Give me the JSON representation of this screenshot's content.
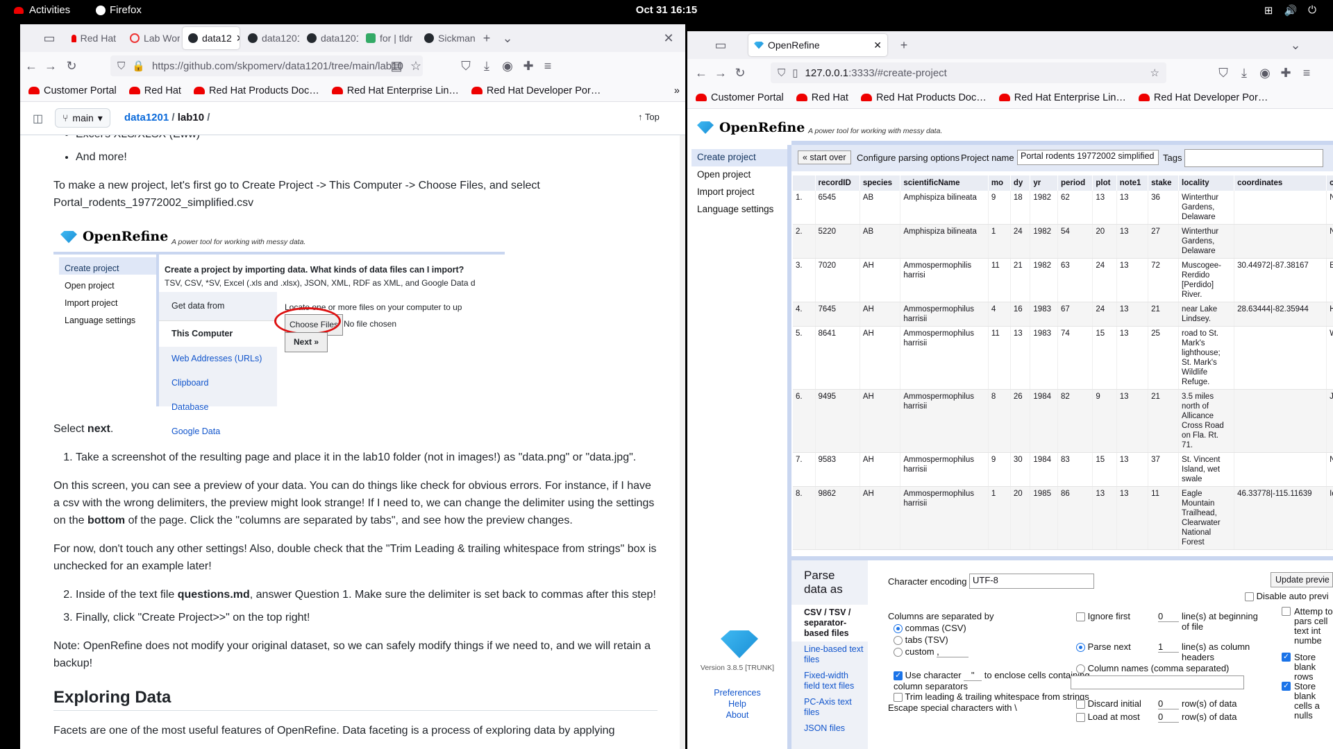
{
  "topbar": {
    "activities": "Activities",
    "app": "Firefox",
    "clock": "Oct 31  16:15"
  },
  "left": {
    "tabs": [
      "Red Hat",
      "Lab Wor",
      "data12",
      "data1201",
      "data1201",
      "for | tldr",
      "Sickman"
    ],
    "url": "https://github.com/skpomerv/data1201/tree/main/lab10",
    "url_host": "github.com",
    "bookmarks": [
      "Customer Portal",
      "Red Hat",
      "Red Hat Products Doc…",
      "Red Hat Enterprise Lin…",
      "Red Hat Developer Por…"
    ],
    "branch": "main",
    "crumb_repo": "data1201",
    "crumb_dir": "lab10",
    "top_label": "Top",
    "bullet1": "Excel's XLS/XLSX (Eww)",
    "bullet2": "And more!",
    "p1": "To make a new project, let's first go to Create Project -> This Computer -> Choose Files, and select Portal_rodents_19772002_simplified.csv",
    "embed": {
      "title": "OpenRefine",
      "tagline": "A power tool for working with messy data.",
      "nav": [
        "Create project",
        "Open project",
        "Import project",
        "Language settings"
      ],
      "heading": "Create a project by importing data. What kinds of data files can I import?",
      "formats": "TSV, CSV, *SV, Excel (.xls and .xlsx), JSON, XML, RDF as XML, and Google Data d",
      "sources_title": "Get data from",
      "sources": [
        "This Computer",
        "Web Addresses (URLs)",
        "Clipboard",
        "Database",
        "Google Data"
      ],
      "locate": "Locate one or more files on your computer to up",
      "choose": "Choose Files",
      "nofile": "No file chosen",
      "next": "Next »"
    },
    "p_select_a": "Select ",
    "p_select_b": "next",
    "p_select_c": ".",
    "ol1": "Take a screenshot of the resulting page and place it in the lab10 folder (not in images!) as \"data.png\" or \"data.jpg\".",
    "p2a": "On this screen, you can see a preview of your data. You can do things like check for obvious errors. For instance, if I have a csv with the wrong delimiters, the preview might look strange! If I need to, we can change the delimiter using the settings on the ",
    "p2b": "bottom",
    "p2c": " of the page. Click the \"columns are separated by tabs\", and see how the preview changes.",
    "p3": "For now, don't touch any other settings! Also, double check that the \"Trim Leading & trailing whitespace from strings\" box is unchecked for an example later!",
    "ol2a": "Inside of the text file ",
    "ol2b": "questions.md",
    "ol2c": ", answer Question 1. Make sure the delimiter is set back to commas after this step!",
    "ol3": "Finally, click \"Create Project>>\" on the top right!",
    "p4": "Note: OpenRefine does not modify your original dataset, so we can safely modify things if we need to, and we will retain a backup!",
    "h2": "Exploring Data",
    "p5": "Facets are one of the most useful features of OpenRefine. Data faceting is a process of exploring data by applying"
  },
  "right": {
    "tab": "OpenRefine",
    "url_host": "127.0.0.1",
    "url_rest": ":3333/#create-project",
    "bookmarks": [
      "Customer Portal",
      "Red Hat",
      "Red Hat Products Doc…",
      "Red Hat Enterprise Lin…",
      "Red Hat Developer Por…"
    ],
    "title": "OpenRefine",
    "tagline": "A power tool for working with messy data.",
    "nav": [
      "Create project",
      "Open project",
      "Import project",
      "Language settings"
    ],
    "start_over": "« start over",
    "configure": "Configure parsing options",
    "project_name_label": "Project name",
    "project_name": "Portal rodents 19772002 simplified",
    "tags_label": "Tags",
    "columns": [
      "",
      "recordID",
      "species",
      "scientificName",
      "mo",
      "dy",
      "yr",
      "period",
      "plot",
      "note1",
      "stake",
      "locality",
      "coordinates",
      "county"
    ],
    "rows": [
      [
        "1.",
        "6545",
        "AB",
        "Amphispiza bilineata",
        "9",
        "18",
        "1982",
        "62",
        "13",
        "13",
        "36",
        "Winterthur Gardens, Delaware",
        "",
        "NULL"
      ],
      [
        "2.",
        "5220",
        "AB",
        "Amphispiza bilineata",
        "1",
        "24",
        "1982",
        "54",
        "20",
        "13",
        "27",
        "Winterthur Gardens, Delaware",
        "",
        "NULL"
      ],
      [
        "3.",
        "7020",
        "AH",
        "Ammospermophilis harrisi",
        "11",
        "21",
        "1982",
        "63",
        "24",
        "13",
        "72",
        "Muscogee-Rerdido [Perdido] River.",
        "30.44972|-87.38167",
        "Escamb"
      ],
      [
        "4.",
        "7645",
        "AH",
        "Ammospermophilus harrisii",
        "4",
        "16",
        "1983",
        "67",
        "24",
        "13",
        "21",
        "near Lake Lindsey.",
        "28.63444|-82.35944",
        "Hernand"
      ],
      [
        "5.",
        "8641",
        "AH",
        "Ammospermophilus harrisii",
        "11",
        "13",
        "1983",
        "74",
        "15",
        "13",
        "25",
        "road to St. Mark's lighthouse; St. Mark's Wildlife Refuge.",
        "",
        "Wakulla"
      ],
      [
        "6.",
        "9495",
        "AH",
        "Ammospermophilus harrisii",
        "8",
        "26",
        "1984",
        "82",
        "9",
        "13",
        "21",
        "3.5 miles north of Allicance Cross Road on Fla. Rt. 71.",
        "",
        "Jackson"
      ],
      [
        "7.",
        "9583",
        "AH",
        "Ammospermophilus harrisii",
        "9",
        "30",
        "1984",
        "83",
        "15",
        "13",
        "37",
        "St. Vincent Island, wet swale",
        "",
        "NULL"
      ],
      [
        "8.",
        "9862",
        "AH",
        "Ammospermophilus harrisii",
        "1",
        "20",
        "1985",
        "86",
        "13",
        "13",
        "11",
        "Eagle Mountain Trailhead, Clearwater National Forest",
        "46.33778|-115.11639",
        "Idaho"
      ]
    ],
    "parse_title": "Parse data as",
    "formats": [
      "CSV / TSV / separator-based files",
      "Line-based text files",
      "Fixed-width field text files",
      "PC-Axis text files",
      "JSON files"
    ],
    "char_enc_label": "Character encoding",
    "char_enc": "UTF-8",
    "update_preview": "Update previe",
    "disable_auto": "Disable auto previ",
    "sep_title": "Columns are separated by",
    "sep_csv": "commas (CSV)",
    "sep_tsv": "tabs (TSV)",
    "sep_custom": "custom",
    "sep_custom_val": ",",
    "use_char": "Use character",
    "quote_char": "\"",
    "use_char_rest": "to enclose cells containing column separators",
    "trim": "Trim leading & trailing whitespace from strings",
    "escape": "Escape special characters with \\",
    "ignore_first": "Ignore first",
    "ignore_val": "0",
    "ignore_rest": "line(s) at beginning of file",
    "parse_next": "Parse next",
    "parse_val": "1",
    "parse_rest": "line(s) as column headers",
    "col_names": "Column names (comma separated)",
    "discard": "Discard initial",
    "discard_val": "0",
    "discard_rest": "row(s) of data",
    "load_most": "Load at most",
    "load_val": "0",
    "load_rest": "row(s) of data",
    "attempt": "Attemp to pars cell text int numbe",
    "store_blank_rows": "Store blank rows",
    "store_blank_cells": "Store blank cells a nulls",
    "version": "Version 3.8.5 [TRUNK]",
    "links": [
      "Preferences",
      "Help",
      "About"
    ]
  }
}
